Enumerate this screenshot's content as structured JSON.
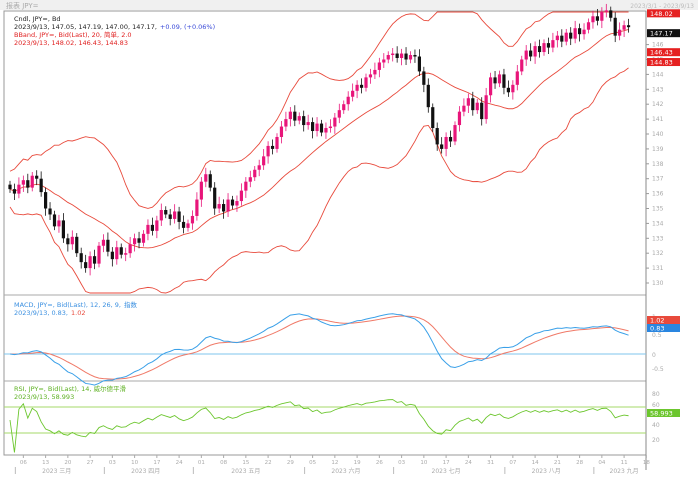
{
  "window": {
    "title": "报表 JPY=",
    "range_label": "2023/3/1 - 2023/9/13"
  },
  "colors": {
    "up": "#e8157a",
    "down": "#111111",
    "bband": "#e84a3c",
    "macd": "#3aa0e8",
    "signal": "#f07a68",
    "rsi": "#6cc62e",
    "rsi_levels": "#a6d96a",
    "zero_line": "#7fc6ec"
  },
  "legends": {
    "price": {
      "line1": "Cndl, JPY=, Bd",
      "line2": "2023/9/13, 147.05, 147.19, 147.00, 147.17,",
      "line2_change": "+0.09, (+0.06%)",
      "bband1": "BBand, JPY=, Bid(Last), 20, 简单, 2.0",
      "bband2": "2023/9/13, 148.02, 146.43, 144.83"
    },
    "macd": {
      "line1": "MACD, JPY=, Bid(Last), 12, 26, 9,",
      "mode": "指数",
      "line2": "2023/9/13, 0.83,",
      "signal_value": "1.02"
    },
    "rsi": {
      "line1": "RSI, JPY=, Bid(Last), 14, 威尔德平滑",
      "line2": "2023/9/13, 58.993"
    }
  },
  "chart_data": [
    {
      "type": "candlestick",
      "title": "Cndl, JPY=, Bd",
      "ylim": [
        129,
        149
      ],
      "yticks": [
        130,
        131,
        132,
        133,
        134,
        135,
        136,
        137,
        138,
        139,
        140,
        141,
        142,
        143,
        144,
        145,
        146
      ],
      "last_close": "147.17",
      "bband_labels": {
        "upper": "148.02",
        "middle": "146.43",
        "lower": "144.83"
      },
      "closes": [
        136.3,
        136.0,
        136.6,
        136.9,
        136.4,
        137.2,
        137.0,
        136.1,
        135.0,
        134.6,
        133.8,
        134.2,
        133.0,
        132.6,
        133.1,
        132.0,
        131.4,
        131.0,
        131.8,
        131.3,
        132.5,
        132.9,
        132.1,
        131.6,
        132.4,
        131.9,
        132.0,
        132.6,
        133.0,
        132.7,
        133.3,
        133.9,
        133.5,
        134.2,
        134.9,
        134.6,
        134.3,
        134.8,
        134.1,
        133.7,
        134.0,
        134.5,
        135.6,
        136.8,
        137.3,
        136.4,
        135.0,
        135.3,
        134.8,
        135.6,
        135.2,
        135.5,
        136.2,
        136.8,
        137.1,
        137.6,
        137.9,
        138.5,
        139.2,
        139.0,
        139.8,
        140.5,
        141.0,
        141.5,
        140.9,
        141.2,
        140.6,
        140.8,
        140.2,
        140.7,
        140.1,
        140.4,
        140.5,
        141.1,
        141.6,
        142.0,
        142.5,
        142.9,
        143.3,
        143.1,
        143.8,
        144.0,
        144.3,
        144.8,
        145.0,
        145.3,
        145.4,
        145.1,
        145.4,
        145.0,
        145.3,
        145.2,
        144.2,
        143.3,
        141.8,
        140.4,
        139.3,
        139.0,
        139.8,
        139.5,
        140.6,
        141.5,
        141.9,
        142.4,
        141.6,
        142.1,
        141.0,
        142.6,
        143.8,
        143.4,
        144.0,
        143.1,
        142.8,
        143.3,
        144.2,
        145.0,
        145.6,
        145.2,
        145.9,
        145.5,
        146.1,
        145.8,
        146.3,
        146.6,
        146.2,
        146.8,
        146.4,
        147.1,
        146.7,
        147.0,
        147.5,
        147.9,
        147.6,
        148.2,
        148.3,
        147.8,
        146.6,
        147.0,
        147.3,
        147.17
      ]
    },
    {
      "type": "line",
      "title": "MACD, JPY=, Bid(Last), 12, 26, 9, 指数",
      "yticks": [
        "1",
        "0.5",
        "0",
        "-0.5"
      ],
      "labels": {
        "macd": "0.83",
        "signal": "1.02"
      }
    },
    {
      "type": "line",
      "title": "RSI, JPY=, Bid(Last), 14, 威尔德平滑",
      "yticks": [
        "80",
        "60",
        "40",
        "20"
      ],
      "levels": [
        70,
        30
      ],
      "label": "58.993"
    }
  ],
  "x_axis": {
    "months": [
      {
        "label": "2023 三月",
        "ticks": [
          "06",
          "13",
          "20",
          "27"
        ]
      },
      {
        "label": "2023 四月",
        "ticks": [
          "03",
          "10",
          "17",
          "24"
        ]
      },
      {
        "label": "2023 五月",
        "ticks": [
          "01",
          "08",
          "15",
          "22",
          "29"
        ]
      },
      {
        "label": "2023 六月",
        "ticks": [
          "05",
          "12",
          "19",
          "26"
        ]
      },
      {
        "label": "2023 七月",
        "ticks": [
          "03",
          "10",
          "17",
          "24",
          "31"
        ]
      },
      {
        "label": "2023 八月",
        "ticks": [
          "07",
          "14",
          "21",
          "28"
        ]
      },
      {
        "label": "2023 九月",
        "ticks": [
          "04",
          "11",
          "18"
        ]
      }
    ]
  }
}
